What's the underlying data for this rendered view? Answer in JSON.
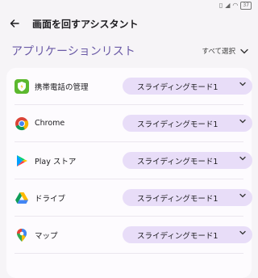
{
  "status": {
    "battery": "37"
  },
  "header": {
    "title": "画面を回すアシスタント"
  },
  "section": {
    "title": "アプリケーションリスト",
    "select_all": "すべて選択"
  },
  "apps": [
    {
      "label": "携帯電話の管理",
      "mode": "スライディングモード1",
      "icon": "phone-manager-icon"
    },
    {
      "label": "Chrome",
      "mode": "スライディングモード1",
      "icon": "chrome-icon"
    },
    {
      "label": "Play ストア",
      "mode": "スライディングモード1",
      "icon": "play-store-icon"
    },
    {
      "label": "ドライブ",
      "mode": "スライディングモード1",
      "icon": "drive-icon"
    },
    {
      "label": "マップ",
      "mode": "スライディングモード1",
      "icon": "maps-icon"
    }
  ],
  "colors": {
    "accent": "#6a5aa6",
    "select_bg": "#e8ddf8",
    "background": "#f6f4f7"
  }
}
